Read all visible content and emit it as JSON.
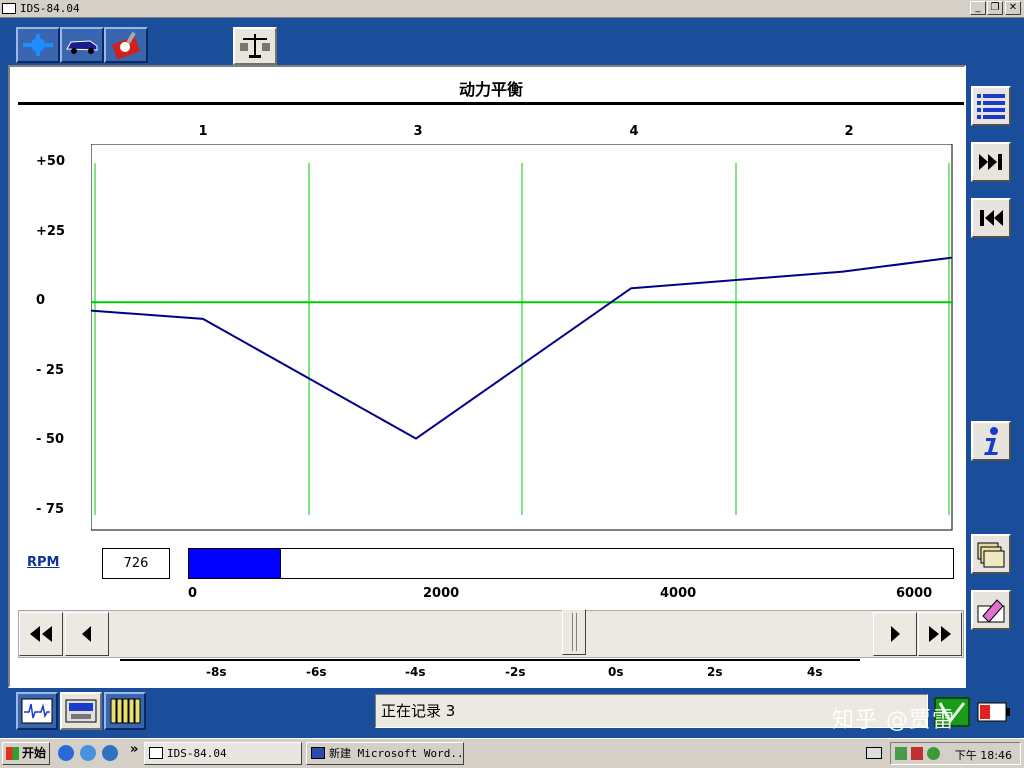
{
  "window": {
    "title": "IDS-84.04",
    "btn_min": "_",
    "btn_restore": "❐",
    "btn_close": "✕"
  },
  "panel": {
    "title": "动力平衡"
  },
  "chart_data": {
    "type": "line",
    "cylinder_labels": [
      "1",
      "3",
      "4",
      "2"
    ],
    "y_ticks": [
      "+50",
      "+25",
      "0",
      "- 25",
      "- 50",
      "- 75"
    ],
    "ylim": [
      -75,
      50
    ],
    "x_positions": [
      0,
      1,
      2,
      3,
      4,
      5
    ],
    "series": [
      {
        "values": [
          -3,
          -6,
          -49,
          5,
          11,
          16
        ]
      }
    ],
    "zero_line": 0,
    "colors": {
      "line": "#00008b",
      "grid": "#00cc00"
    }
  },
  "rpm": {
    "label": "RPM",
    "value": "726",
    "fraction": 0.121,
    "ticks": [
      "0",
      "2000",
      "4000",
      "6000"
    ]
  },
  "timeline": {
    "ticks": [
      "-8s",
      "-6s",
      "-4s",
      "-2s",
      "0s",
      "2s",
      "4s"
    ],
    "position_fraction": 0.6
  },
  "status": {
    "text": "正在记录 3"
  },
  "watermark": "知乎 @贾雷",
  "taskbar": {
    "start": "开始",
    "tasks": [
      "IDS-84.04",
      "新建 Microsoft Word..."
    ],
    "clock": "下午 18:46",
    "chevron": "»"
  }
}
